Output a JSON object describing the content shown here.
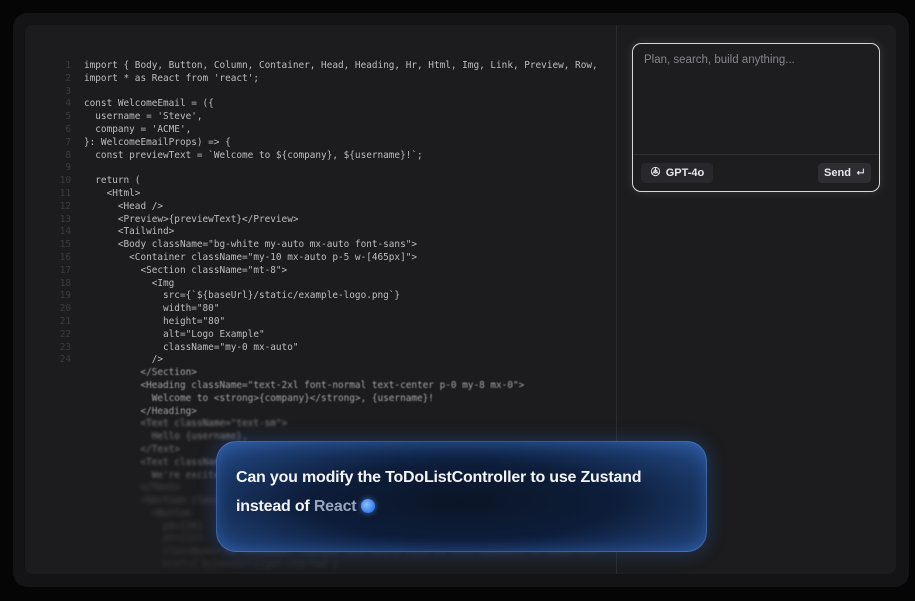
{
  "editor": {
    "lines": [
      {
        "n": "1",
        "t": "import { Body, Button, Column, Container, Head, Heading, Hr, Html, Img, Link, Preview, Row,"
      },
      {
        "n": "2",
        "t": "import * as React from 'react';"
      },
      {
        "n": "3",
        "t": ""
      },
      {
        "n": "4",
        "t": "const WelcomeEmail = ({"
      },
      {
        "n": "5",
        "t": "  username = 'Steve',"
      },
      {
        "n": "6",
        "t": "  company = 'ACME',"
      },
      {
        "n": "7",
        "t": "}: WelcomeEmailProps) => {"
      },
      {
        "n": "8",
        "t": "  const previewText = `Welcome to ${company}, ${username}!`;"
      },
      {
        "n": "9",
        "t": ""
      },
      {
        "n": "10",
        "t": "  return ("
      },
      {
        "n": "11",
        "t": "    <Html>"
      },
      {
        "n": "12",
        "t": "      <Head />"
      },
      {
        "n": "13",
        "t": "      <Preview>{previewText}</Preview>"
      },
      {
        "n": "14",
        "t": "      <Tailwind>"
      },
      {
        "n": "15",
        "t": "      <Body className=\"bg-white my-auto mx-auto font-sans\">"
      },
      {
        "n": "16",
        "t": "        <Container className=\"my-10 mx-auto p-5 w-[465px]\">"
      },
      {
        "n": "17",
        "t": "          <Section className=\"mt-8\">"
      },
      {
        "n": "18",
        "t": "            <Img"
      },
      {
        "n": "19",
        "t": "              src={`${baseUrl}/static/example-logo.png`}"
      },
      {
        "n": "20",
        "t": "              width=\"80\""
      },
      {
        "n": "21",
        "t": "              height=\"80\""
      },
      {
        "n": "22",
        "t": "              alt=\"Logo Example\""
      },
      {
        "n": "23",
        "t": "              className=\"my-0 mx-auto\""
      },
      {
        "n": "24",
        "t": "            />"
      },
      {
        "n": "",
        "t": "          </Section>"
      },
      {
        "n": "",
        "t": "          <Heading className=\"text-2xl font-normal text-center p-0 my-8 mx-0\">"
      },
      {
        "n": "",
        "t": "            Welcome to <strong>{company}</strong>, {username}!"
      },
      {
        "n": "",
        "t": "          </Heading>"
      },
      {
        "n": "",
        "t": "          <Text className=\"text-sm\">"
      },
      {
        "n": "",
        "t": "            Hello {username},"
      },
      {
        "n": "",
        "t": "          </Text>"
      },
      {
        "n": "",
        "t": "          <Text className=\"text-sm\">"
      },
      {
        "n": "",
        "t": "            We're excited to have you onboard at {company}."
      },
      {
        "n": "",
        "t": "          </Text>"
      },
      {
        "n": "",
        "t": "          <Section className=\"text-center mt-[32px] mb-[32px]\">"
      },
      {
        "n": "",
        "t": "            <Button"
      },
      {
        "n": "",
        "t": "              pX={20}"
      },
      {
        "n": "",
        "t": "              pY={12}"
      },
      {
        "n": "",
        "t": "              className=\"bg-[#000000] rounded text-white text-xs font-semibold no-underline\""
      },
      {
        "n": "",
        "t": "              href={`${baseUrl}/get-started`}"
      }
    ]
  },
  "chat": {
    "placeholder": "Plan, search, build anything...",
    "model_label": "GPT-4o",
    "model_icon": "openai-icon",
    "send_label": "Send",
    "send_icon": "enter-key-icon"
  },
  "prompt": {
    "text_main": "Can you modify the ToDoListController to use Zustand instead of ",
    "text_typing": "React"
  }
}
